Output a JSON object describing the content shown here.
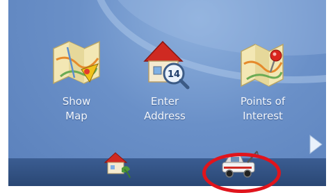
{
  "menu": {
    "items": [
      {
        "label_line1": "Show",
        "label_line2": "Map",
        "icon": "map-icon"
      },
      {
        "label_line1": "Enter",
        "label_line2": "Address",
        "icon": "house-address-icon",
        "badge": "14"
      },
      {
        "label_line1": "Points of",
        "label_line2": "Interest",
        "icon": "poi-map-pin-icon"
      }
    ],
    "next_icon": "chevron-right-icon"
  },
  "bottom_bar": {
    "home_icon": "home-icon",
    "tow_icon": "tow-truck-icon",
    "highlight_color": "#e0141c"
  },
  "colors": {
    "background": "#6a90c8",
    "bar": "#2a4774",
    "label": "#f2f6fc"
  }
}
